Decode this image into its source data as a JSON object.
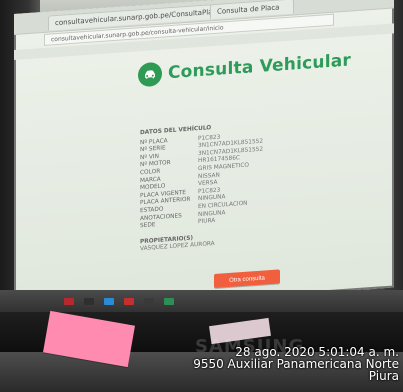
{
  "browser": {
    "tabs": [
      {
        "label": "consultavehicular.sunarp.gob.pe/ConsultaPlaca/..."
      },
      {
        "label": "Consulta de Placa"
      }
    ],
    "address": "consultavehicular.sunarp.gob.pe/consulta-vehicular/inicio"
  },
  "page": {
    "title": "Consulta Vehicular",
    "data_section_title": "DATOS DEL VEHÍCULO",
    "fields": [
      {
        "key": "Nº PLACA",
        "value": "P1C823"
      },
      {
        "key": "Nº SERIE",
        "value": "3N1CN7AD1KL851552"
      },
      {
        "key": "Nº VIN",
        "value": "3N1CN7AD1KL851552"
      },
      {
        "key": "Nº MOTOR",
        "value": "HR16174586C"
      },
      {
        "key": "COLOR",
        "value": "GRIS MAGNETICO"
      },
      {
        "key": "MARCA",
        "value": "NISSAN"
      },
      {
        "key": "MODELO",
        "value": "VERSA"
      },
      {
        "key": "PLACA VIGENTE",
        "value": "P1C823"
      },
      {
        "key": "PLACA ANTERIOR",
        "value": "NINGUNA"
      },
      {
        "key": "ESTADO",
        "value": "EN CIRCULACION"
      },
      {
        "key": "ANOTACIONES",
        "value": "NINGUNA"
      },
      {
        "key": "SEDE",
        "value": "PIURA"
      }
    ],
    "owners_title": "PROPIETARIO(S)",
    "owners_value": "VASQUEZ LOPEZ AURORA",
    "button_label": "Otra consulta"
  },
  "overlay": {
    "timestamp": "28 ago. 2020 5:01:04 a. m.",
    "address_line_1": "9550 Auxiliar Panamericana Norte",
    "address_line_2": "Piura"
  },
  "brand": {
    "label": "SAMSUNG"
  },
  "colors": {
    "accent": "#2e9b5b",
    "button": "#f05f3e"
  }
}
